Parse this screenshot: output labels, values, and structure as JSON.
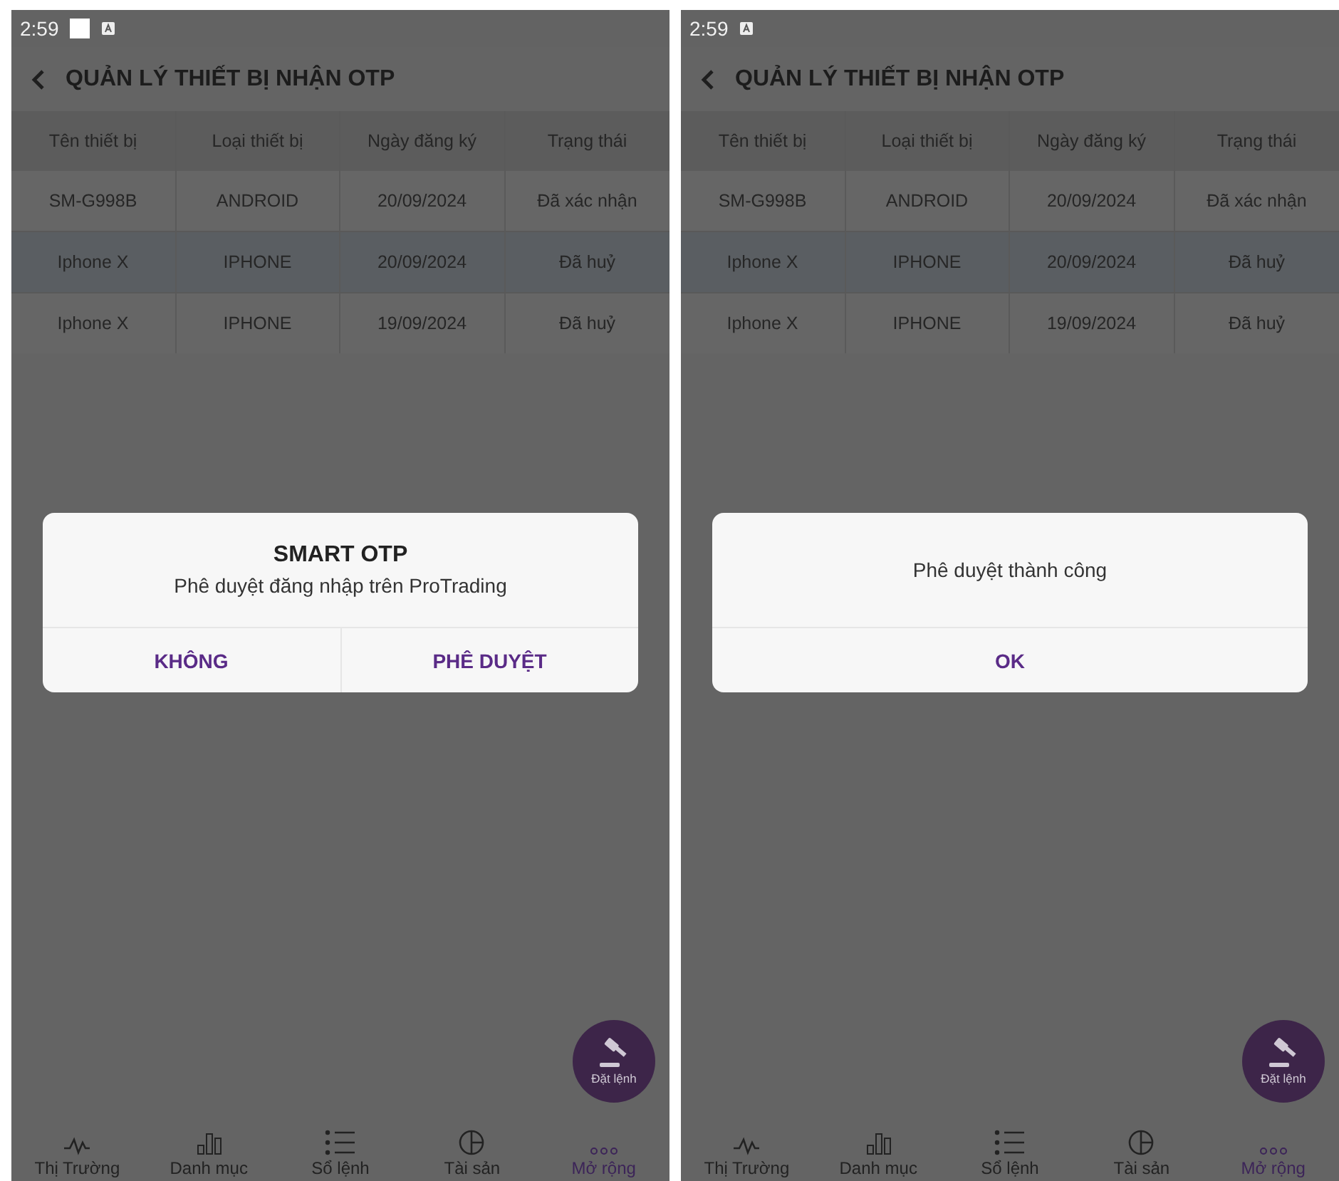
{
  "screens": [
    {
      "status_bar": {
        "time": "2:59",
        "notification_shown": true
      },
      "title": "QUẢN LÝ THIẾT BỊ NHẬN OTP",
      "table": {
        "columns": [
          "Tên thiết bị",
          "Loại thiết bị",
          "Ngày đăng ký",
          "Trạng thái"
        ],
        "rows": [
          {
            "cells": [
              "SM-G998B",
              "ANDROID",
              "20/09/2024",
              "Đã xác nhận"
            ],
            "selected": false
          },
          {
            "cells": [
              "Iphone X",
              "IPHONE",
              "20/09/2024",
              "Đã huỷ"
            ],
            "selected": true
          },
          {
            "cells": [
              "Iphone X",
              "IPHONE",
              "19/09/2024",
              "Đã huỷ"
            ],
            "selected": false
          }
        ]
      },
      "dialog": {
        "title": "SMART OTP",
        "message": "Phê duyệt đăng nhập trên ProTrading",
        "buttons": [
          "KHÔNG",
          "PHÊ DUYỆT"
        ]
      },
      "fab": {
        "label": "Đặt lệnh"
      },
      "bottom_nav": [
        {
          "kind": "pulse",
          "label": "Thị Trường",
          "selected": false
        },
        {
          "kind": "bars",
          "label": "Danh mục",
          "selected": false
        },
        {
          "kind": "list",
          "label": "Sổ lệnh",
          "selected": false
        },
        {
          "kind": "pie",
          "label": "Tài sản",
          "selected": false
        },
        {
          "kind": "more",
          "label": "Mở rộng",
          "selected": true
        }
      ]
    },
    {
      "status_bar": {
        "time": "2:59",
        "notification_shown": false
      },
      "title": "QUẢN LÝ THIẾT BỊ NHẬN OTP",
      "table": {
        "columns": [
          "Tên thiết bị",
          "Loại thiết bị",
          "Ngày đăng ký",
          "Trạng thái"
        ],
        "rows": [
          {
            "cells": [
              "SM-G998B",
              "ANDROID",
              "20/09/2024",
              "Đã xác nhận"
            ],
            "selected": false
          },
          {
            "cells": [
              "Iphone X",
              "IPHONE",
              "20/09/2024",
              "Đã huỷ"
            ],
            "selected": true
          },
          {
            "cells": [
              "Iphone X",
              "IPHONE",
              "19/09/2024",
              "Đã huỷ"
            ],
            "selected": false
          }
        ]
      },
      "dialog": {
        "message": "Phê duyệt thành công",
        "buttons": [
          "OK"
        ]
      },
      "fab": {
        "label": "Đặt lệnh"
      },
      "bottom_nav": [
        {
          "kind": "pulse",
          "label": "Thị Trường",
          "selected": false
        },
        {
          "kind": "bars",
          "label": "Danh mục",
          "selected": false
        },
        {
          "kind": "list",
          "label": "Sổ lệnh",
          "selected": false
        },
        {
          "kind": "pie",
          "label": "Tài sản",
          "selected": false
        },
        {
          "kind": "more",
          "label": "Mở rộng",
          "selected": true
        }
      ]
    }
  ]
}
